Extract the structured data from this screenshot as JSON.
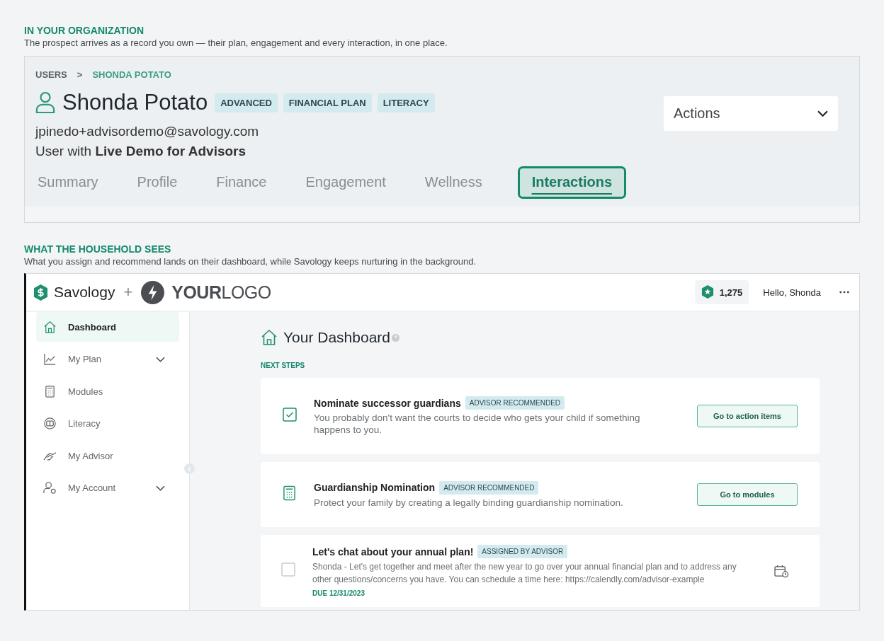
{
  "intro_1": {
    "heading": "IN YOUR ORGANIZATION",
    "text": "The prospect arrives as a record you own — their plan, engagement and every interaction, in one place."
  },
  "profile": {
    "breadcrumb": [
      {
        "label": "USERS",
        "selected": false
      },
      {
        "label": ">",
        "selected": false
      },
      {
        "label": "SHONDA POTATO",
        "selected": true
      }
    ],
    "name": "Shonda Potato",
    "tags": [
      "ADVANCED",
      "FINANCIAL PLAN",
      "LITERACY"
    ],
    "email": "jpinedo+advisordemo@savology.com",
    "subtitle": "User with **Live Demo for Advisors**",
    "actions": "Actions",
    "tabs": [
      {
        "label": "Summary",
        "selected": false
      },
      {
        "label": "Profile",
        "selected": false
      },
      {
        "label": "Finance",
        "selected": false
      },
      {
        "label": "Engagement",
        "selected": false
      },
      {
        "label": "Wellness",
        "selected": false
      },
      {
        "label": "Interactions",
        "selected": true
      }
    ]
  },
  "intro_2": {
    "heading": "WHAT THE HOUSEHOLD SEES",
    "text": "What you assign and recommend lands on their dashboard, while Savology keeps nurturing in the background."
  },
  "app": {
    "brand": "Savology",
    "plus": "+",
    "partner_logo": "**YOUR**LOGO",
    "points": "1,275",
    "greeting": "Hello, Shonda",
    "sidebar": [
      {
        "kind": "home",
        "label": "Dashboard",
        "selected": true,
        "expandable": false
      },
      {
        "kind": "chart",
        "label": "My Plan",
        "selected": false,
        "expandable": true
      },
      {
        "kind": "calculator",
        "label": "Modules",
        "selected": false,
        "expandable": false
      },
      {
        "kind": "book",
        "label": "Literacy",
        "selected": false,
        "expandable": false
      },
      {
        "kind": "handshake",
        "label": "My Advisor",
        "selected": false,
        "expandable": false
      },
      {
        "kind": "account",
        "label": "My Account",
        "selected": false,
        "expandable": true
      }
    ],
    "title": "Your Dashboard",
    "section_label": "NEXT STEPS",
    "cards": [
      {
        "kind": "task",
        "checked": true,
        "title": "Nominate successor guardians",
        "tag": "ADVISOR RECOMMENDED",
        "text": "You probably don't want the courts to decide who gets your child if something happens to you.",
        "button": "Go to action items"
      },
      {
        "kind": "module",
        "title": "Guardianship Nomination",
        "tag": "ADVISOR RECOMMENDED",
        "text": "Protect your family by creating a legally binding guardianship nomination.",
        "button": "Go to modules"
      },
      {
        "kind": "assignment",
        "checked": false,
        "title": "Let's chat about your annual plan!",
        "tag": "ASSIGNED BY ADVISOR",
        "text": "Shonda - Let's get together and meet after the new year to go over your annual financial plan and to address any other questions/concerns you have. You can schedule a time here: https://calendly.com/advisor-example",
        "due": "DUE 12/31/2023"
      }
    ]
  }
}
